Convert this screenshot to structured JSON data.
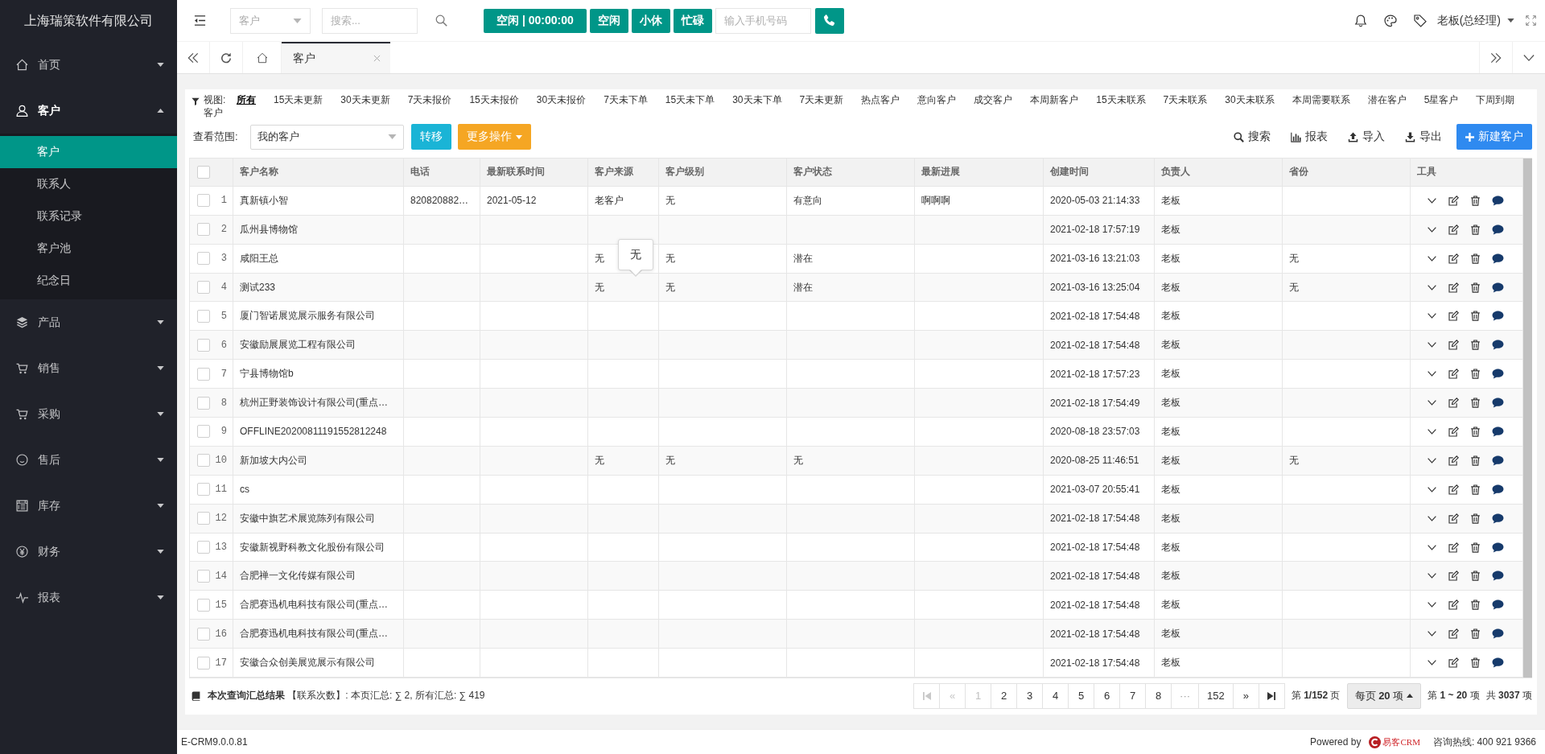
{
  "sidebar": {
    "title": "上海瑞策软件有限公司",
    "items": [
      {
        "label": "首页",
        "expanded": false
      },
      {
        "label": "客户",
        "expanded": true,
        "children": [
          {
            "label": "客户",
            "selected": true
          },
          {
            "label": "联系人",
            "selected": false
          },
          {
            "label": "联系记录",
            "selected": false
          },
          {
            "label": "客户池",
            "selected": false
          },
          {
            "label": "纪念日",
            "selected": false
          }
        ]
      },
      {
        "label": "产品",
        "expanded": false
      },
      {
        "label": "销售",
        "expanded": false
      },
      {
        "label": "采购",
        "expanded": false
      },
      {
        "label": "售后",
        "expanded": false
      },
      {
        "label": "库存",
        "expanded": false
      },
      {
        "label": "财务",
        "expanded": false
      },
      {
        "label": "报表",
        "expanded": false
      }
    ]
  },
  "top_bar": {
    "module_select": {
      "placeholder": "客户"
    },
    "search": {
      "placeholder": "搜索..."
    },
    "status_buttons": [
      "空闲 | 00:00:00",
      "空闲",
      "小休",
      "忙碌"
    ],
    "phone": {
      "placeholder": "输入手机号码"
    },
    "user": "老板(总经理)"
  },
  "tabs": [
    {
      "label": "客户",
      "selected": true
    }
  ],
  "views": {
    "label": "视图: 客户",
    "items": [
      {
        "label": "所有",
        "selected": true
      },
      {
        "label": "15天未更新",
        "selected": false
      },
      {
        "label": "30天未更新",
        "selected": false
      },
      {
        "label": "7天未报价",
        "selected": false
      },
      {
        "label": "15天未报价",
        "selected": false
      },
      {
        "label": "30天未报价",
        "selected": false
      },
      {
        "label": "7天未下单",
        "selected": false
      },
      {
        "label": "15天未下单",
        "selected": false
      },
      {
        "label": "30天未下单",
        "selected": false
      },
      {
        "label": "7天未更新",
        "selected": false
      },
      {
        "label": "热点客户",
        "selected": false
      },
      {
        "label": "意向客户",
        "selected": false
      },
      {
        "label": "成交客户",
        "selected": false
      },
      {
        "label": "本周新客户",
        "selected": false
      },
      {
        "label": "15天未联系",
        "selected": false
      },
      {
        "label": "7天未联系",
        "selected": false
      },
      {
        "label": "30天未联系",
        "selected": false
      },
      {
        "label": "本周需要联系",
        "selected": false
      },
      {
        "label": "潜在客户",
        "selected": false
      },
      {
        "label": "5星客户",
        "selected": false
      },
      {
        "label": "下周到期",
        "selected": false
      }
    ]
  },
  "toolbar": {
    "scope": {
      "label": "查看范围:",
      "value": "我的客户"
    },
    "buttons": [
      {
        "label": "转移",
        "kind": "info"
      },
      {
        "label": "更多操作",
        "kind": "dropdown"
      }
    ],
    "actions": [
      "搜索",
      "报表",
      "导入",
      "导出"
    ],
    "create": "新建客户"
  },
  "table": {
    "header_checked": false,
    "columns": [
      "客户名称",
      "电话",
      "最新联系时间",
      "客户来源",
      "客户级别",
      "客户状态",
      "最新进展",
      "创建时间",
      "负责人",
      "省份",
      "工具"
    ],
    "rows": [
      {
        "index": "1",
        "checked": false,
        "name": "真新镇小智",
        "phone": "820820882…",
        "last_contact": "2021-05-12",
        "source": "老客户",
        "level": "无",
        "status": "有意向",
        "progress": "啊啊啊",
        "created": "2020-05-03 21:14:33",
        "owner": "老板"
      },
      {
        "index": "2",
        "checked": false,
        "name": "瓜州县博物馆",
        "created": "2021-02-18 17:57:19",
        "owner": "老板"
      },
      {
        "index": "3",
        "checked": false,
        "name": "咸阳王总",
        "source": "无",
        "level": "无",
        "status": "潜在",
        "created": "2021-03-16 13:21:03",
        "owner": "老板",
        "province": "无"
      },
      {
        "index": "4",
        "checked": false,
        "name": "测试233",
        "source": "无",
        "level": "无",
        "status": "潜在",
        "created": "2021-03-16 13:25:04",
        "owner": "老板",
        "province": "无"
      },
      {
        "index": "5",
        "checked": false,
        "name": "厦门智诺展览展示服务有限公司",
        "created": "2021-02-18 17:54:48",
        "owner": "老板"
      },
      {
        "index": "6",
        "checked": false,
        "name": "安徽励展展览工程有限公司",
        "created": "2021-02-18 17:54:48",
        "owner": "老板"
      },
      {
        "index": "7",
        "checked": false,
        "name": "宁县博物馆b",
        "created": "2021-02-18 17:57:23",
        "owner": "老板"
      },
      {
        "index": "8",
        "checked": false,
        "name": "杭州正野装饰设计有限公司(重点…",
        "created": "2021-02-18 17:54:49",
        "owner": "老板"
      },
      {
        "index": "9",
        "checked": false,
        "name": "OFFLINE20200811191552812248",
        "created": "2020-08-18 23:57:03",
        "owner": "老板"
      },
      {
        "index": "10",
        "checked": false,
        "name": "新加坡大内公司",
        "source": "无",
        "level": "无",
        "status": "无",
        "created": "2020-08-25 11:46:51",
        "owner": "老板",
        "province": "无"
      },
      {
        "index": "11",
        "checked": false,
        "name": "cs",
        "created": "2021-03-07 20:55:41",
        "owner": "老板"
      },
      {
        "index": "12",
        "checked": false,
        "name": "安徽中旗艺术展览陈列有限公司",
        "created": "2021-02-18 17:54:48",
        "owner": "老板"
      },
      {
        "index": "13",
        "checked": false,
        "name": "安徽新视野科教文化股份有限公司",
        "created": "2021-02-18 17:54:48",
        "owner": "老板"
      },
      {
        "index": "14",
        "checked": false,
        "name": "合肥禅一文化传媒有限公司",
        "created": "2021-02-18 17:54:48",
        "owner": "老板"
      },
      {
        "index": "15",
        "checked": false,
        "name": "合肥赛迅机电科技有限公司(重点…",
        "created": "2021-02-18 17:54:48",
        "owner": "老板"
      },
      {
        "index": "16",
        "checked": false,
        "name": "合肥赛迅机电科技有限公司(重点…",
        "created": "2021-02-18 17:54:48",
        "owner": "老板"
      },
      {
        "index": "17",
        "checked": false,
        "name": "安徽合众创美展览展示有限公司",
        "created": "2021-02-18 17:54:48",
        "owner": "老板"
      }
    ]
  },
  "tooltip": {
    "text": "无"
  },
  "pagination": {
    "summary": "**本次查询汇总结果** 【联系次数】: 本页汇总: ∑ 2, 所有汇总: ∑ 419",
    "first": {
      "disabled": true
    },
    "prev": {
      "label": "«",
      "disabled": true
    },
    "pages": [
      {
        "kind": "page",
        "label": "1",
        "selected": true
      },
      {
        "kind": "page",
        "label": "2",
        "selected": false
      },
      {
        "kind": "page",
        "label": "3",
        "selected": false
      },
      {
        "kind": "page",
        "label": "4",
        "selected": false
      },
      {
        "kind": "page",
        "label": "5",
        "selected": false
      },
      {
        "kind": "page",
        "label": "6",
        "selected": false
      },
      {
        "kind": "page",
        "label": "7",
        "selected": false
      },
      {
        "kind": "page",
        "label": "8",
        "selected": false
      },
      {
        "kind": "ellipsis",
        "label": "···",
        "selected": false
      },
      {
        "kind": "page",
        "label": "152",
        "selected": false
      }
    ],
    "next": {
      "label": "»",
      "disabled": false
    },
    "last": {
      "disabled": false
    },
    "page_info": "第 **1/152** 页",
    "page_size": "每页 **20** 项",
    "range": "第 **1 ~ 20** 项",
    "total": "共 **3037** 项"
  },
  "footer": {
    "version": "E-CRM9.0.0.81",
    "powered_by": "Powered by",
    "logo_text": "易客CRM",
    "hotline": "咨询热线: 400 921 9366"
  }
}
